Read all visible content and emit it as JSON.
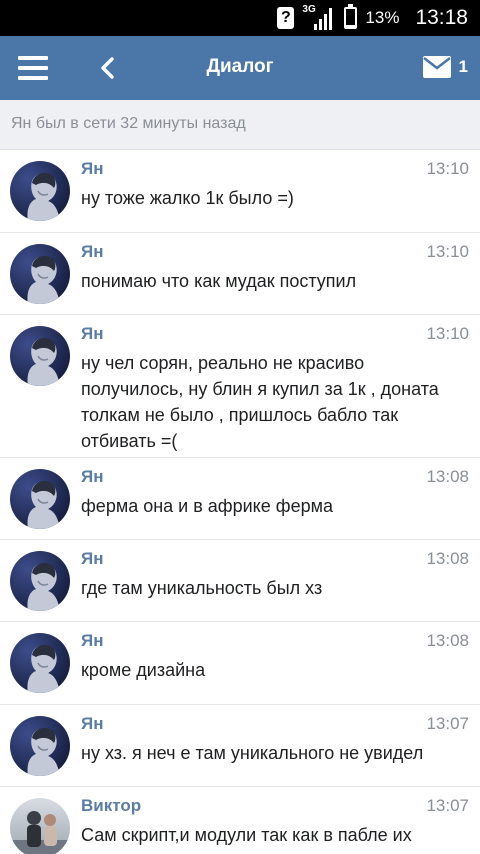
{
  "status_bar": {
    "network": "3G",
    "battery": "13%",
    "battery_level": 0.13,
    "time": "13:18"
  },
  "header": {
    "title": "Диалог",
    "unread_count": "1",
    "menu_icon": "hamburger-menu-icon",
    "back_icon": "chevron-left-icon",
    "mail_icon": "envelope-icon",
    "color": "#4a76a8"
  },
  "status_line": "Ян был в сети 32 минуты назад",
  "messages": [
    {
      "author": "Ян",
      "time": "13:10",
      "text": "ну тоже жалко 1к было =)"
    },
    {
      "author": "Ян",
      "time": "13:10",
      "text": "понимаю что как мудак поступил"
    },
    {
      "author": "Ян",
      "time": "13:10",
      "text": "ну чел сорян, реально не красиво получилось, ну блин я купил за 1к , доната толкам не было , пришлось бабло так отбивать =("
    },
    {
      "author": "Ян",
      "time": "13:08",
      "text": "ферма она и в африке ферма"
    },
    {
      "author": "Ян",
      "time": "13:08",
      "text": "где там уникальность был хз"
    },
    {
      "author": "Ян",
      "time": "13:08",
      "text": "кроме дизайна"
    },
    {
      "author": "Ян",
      "time": "13:07",
      "text": "ну хз. я неч е там уникального не увидел"
    },
    {
      "author": "Виктор",
      "time": "13:07",
      "text": "Сам скрипт,и модули так как в пабле их"
    }
  ],
  "colors": {
    "author": "#5b7ca3",
    "time": "#8a8f96",
    "status_bg": "#eef0f3"
  }
}
